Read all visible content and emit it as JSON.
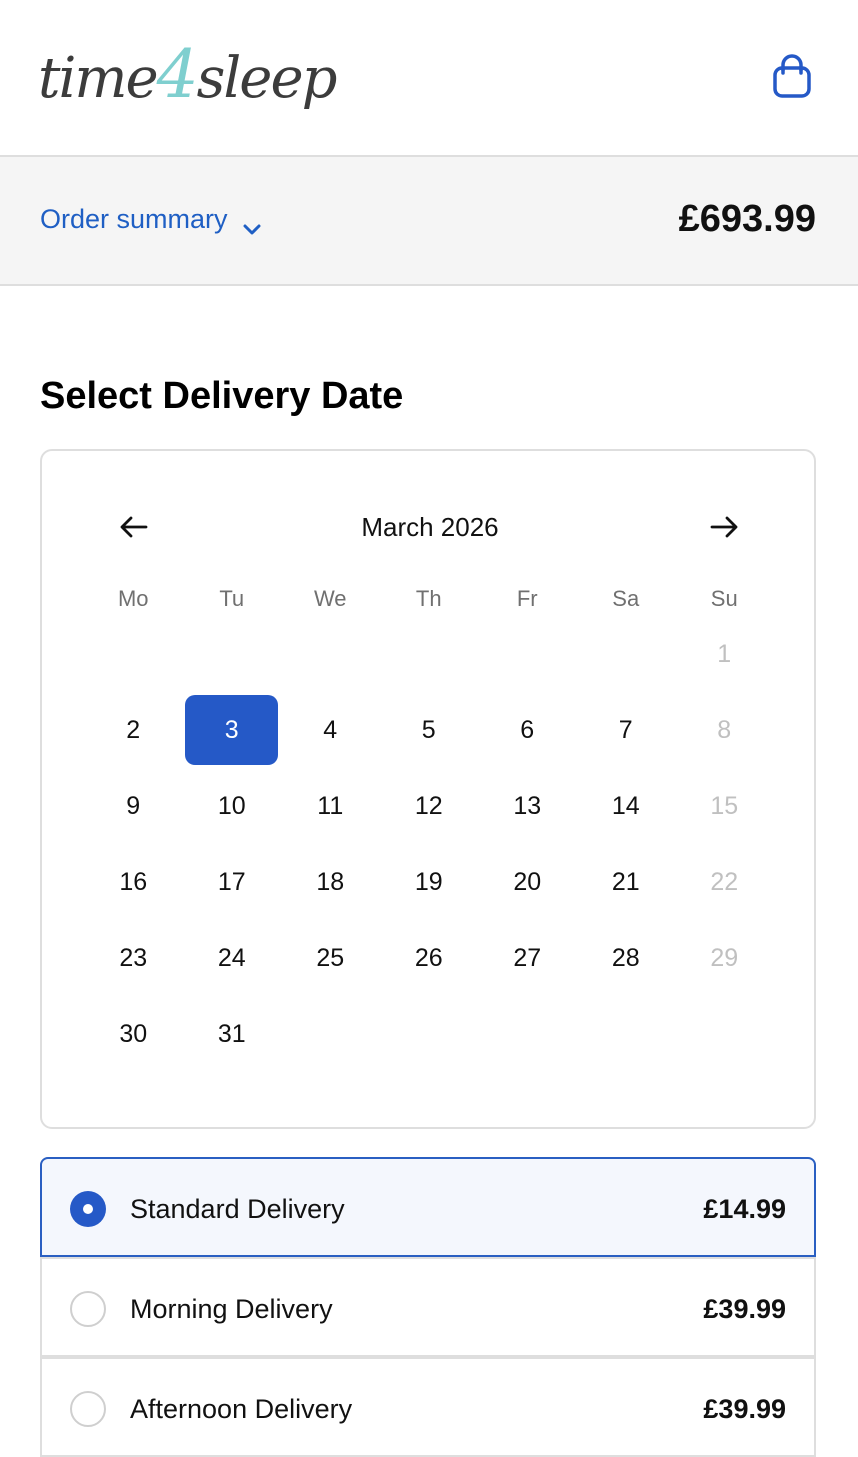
{
  "header": {
    "logo": {
      "part1": "time",
      "part2": "4",
      "part3": "sleep"
    },
    "bag_icon": "shopping-bag-icon"
  },
  "summary": {
    "label": "Order summary",
    "total": "£693.99",
    "chevron_icon": "chevron-down-icon"
  },
  "delivery": {
    "title": "Select Delivery Date",
    "calendar": {
      "month_label": "March 2026",
      "prev_icon": "arrow-left-icon",
      "next_icon": "arrow-right-icon",
      "weekdays": [
        "Mo",
        "Tu",
        "We",
        "Th",
        "Fr",
        "Sa",
        "Su"
      ],
      "weeks": [
        [
          "",
          "",
          "",
          "",
          "",
          "",
          "1"
        ],
        [
          "2",
          "3",
          "4",
          "5",
          "6",
          "7",
          "8"
        ],
        [
          "9",
          "10",
          "11",
          "12",
          "13",
          "14",
          "15"
        ],
        [
          "16",
          "17",
          "18",
          "19",
          "20",
          "21",
          "22"
        ],
        [
          "23",
          "24",
          "25",
          "26",
          "27",
          "28",
          "29"
        ],
        [
          "30",
          "31",
          "",
          "",
          "",
          "",
          ""
        ]
      ],
      "selected_day": "3",
      "disabled_days": [
        "1",
        "8",
        "15",
        "22",
        "29"
      ]
    },
    "options": [
      {
        "label": "Standard Delivery",
        "price": "£14.99",
        "selected": true
      },
      {
        "label": "Morning Delivery",
        "price": "£39.99",
        "selected": false
      },
      {
        "label": "Afternoon Delivery",
        "price": "£39.99",
        "selected": false
      }
    ]
  },
  "colors": {
    "accent": "#2559c7",
    "link": "#1f5fc4",
    "logo_text": "#3c3c3c",
    "logo_accent": "#7fcfcf",
    "disabled": "#c0c0c0"
  }
}
